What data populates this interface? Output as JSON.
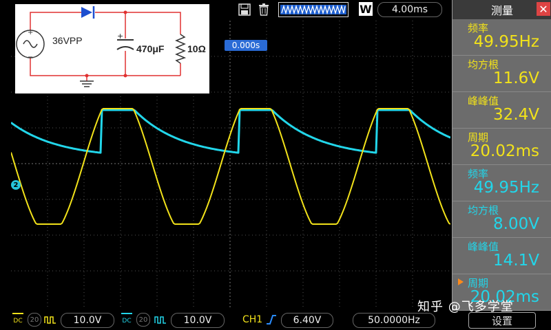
{
  "toolbar": {
    "save_icon": "save-icon",
    "trash_icon": "trash-icon",
    "wave_icon": "waveform-overview-icon",
    "mode_label": "W",
    "timebase": "4.00ms"
  },
  "screen": {
    "trigger_position": "0.000s",
    "channel_marker": "2"
  },
  "schematic": {
    "source_label": "36VPP",
    "plus_sign": "+",
    "minus_sign": "−",
    "cap_label": "470μF",
    "cap_plus": "+",
    "res_label": "10Ω"
  },
  "panel": {
    "title": "测量",
    "close_label": "✕",
    "items": [
      {
        "label": "频率",
        "value": "49.95Hz",
        "color": "#f2e21a"
      },
      {
        "label": "均方根",
        "value": "11.6V",
        "color": "#f2e21a"
      },
      {
        "label": "峰峰值",
        "value": "32.4V",
        "color": "#f2e21a"
      },
      {
        "label": "周期",
        "value": "20.02ms",
        "color": "#f2e21a"
      },
      {
        "label": "频率",
        "value": "49.95Hz",
        "color": "#22d6ea"
      },
      {
        "label": "均方根",
        "value": "8.00V",
        "color": "#22d6ea"
      },
      {
        "label": "峰峰值",
        "value": "14.1V",
        "color": "#22d6ea"
      },
      {
        "label": "周期",
        "value": "20.02ms",
        "color": "#22d6ea"
      }
    ]
  },
  "bottom": {
    "ch1_coupling": "DC",
    "ch1_ratio": "20",
    "ch1_scale": "10.0V",
    "ch2_coupling": "DC",
    "ch2_ratio": "20",
    "ch2_scale": "10.0V",
    "trigger_source": "CH1",
    "trigger_level": "6.40V",
    "frequency": "50.0000Hz",
    "settings_label": "设置"
  },
  "watermark": "知乎 @飞多学堂",
  "colors": {
    "ch1": "#f2e21a",
    "ch2": "#22d6ea",
    "accent": "#2a6bd6"
  }
}
